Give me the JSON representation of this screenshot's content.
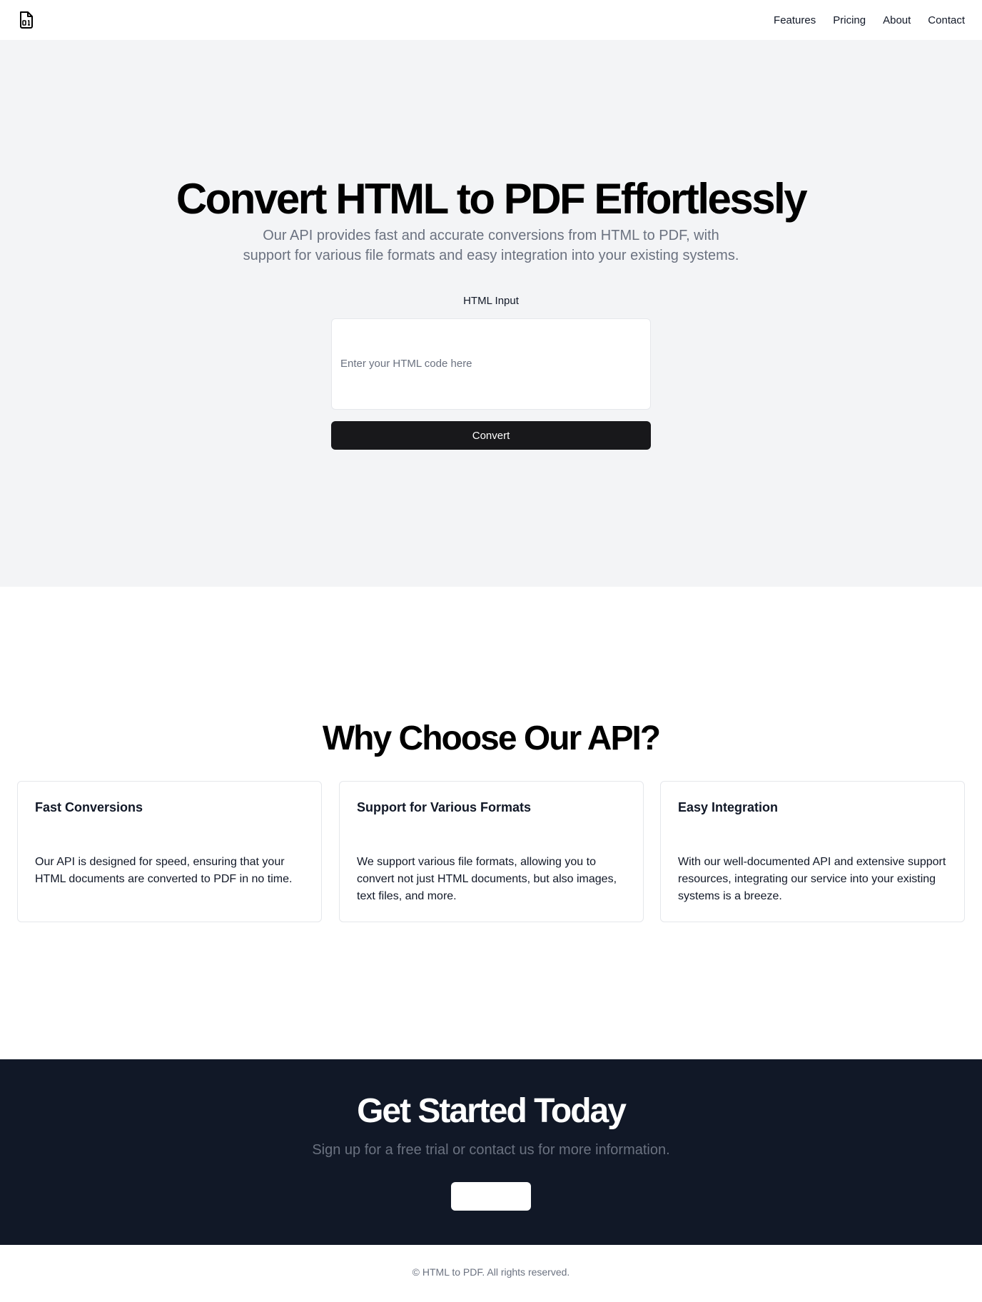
{
  "header": {
    "logo_icon": "file-binary-icon",
    "nav": [
      {
        "label": "Features"
      },
      {
        "label": "Pricing"
      },
      {
        "label": "About"
      },
      {
        "label": "Contact"
      }
    ]
  },
  "hero": {
    "title": "Convert HTML to PDF Effortlessly",
    "subtitle": "Our API provides fast and accurate conversions from HTML to PDF, with support for various file formats and easy integration into your existing systems.",
    "input_label": "HTML Input",
    "input_placeholder": "Enter your HTML code here",
    "input_value": "",
    "convert_label": "Convert"
  },
  "features": {
    "title": "Why Choose Our API?",
    "cards": [
      {
        "title": "Fast Conversions",
        "body": "Our API is designed for speed, ensuring that your HTML documents are converted to PDF in no time."
      },
      {
        "title": "Support for Various Formats",
        "body": "We support various file formats, allowing you to convert not just HTML documents, but also images, text files, and more."
      },
      {
        "title": "Easy Integration",
        "body": "With our well-documented API and extensive support resources, integrating our service into your existing systems is a breeze."
      }
    ]
  },
  "cta": {
    "title": "Get Started Today",
    "subtitle": "Sign up for a free trial or contact us for more information.",
    "button_label": ""
  },
  "footer": {
    "text": "© HTML to PDF. All rights reserved."
  },
  "colors": {
    "hero_bg": "#f3f4f6",
    "cta_bg": "#111827",
    "button_dark": "#18181b",
    "muted_text": "#6b7280"
  }
}
